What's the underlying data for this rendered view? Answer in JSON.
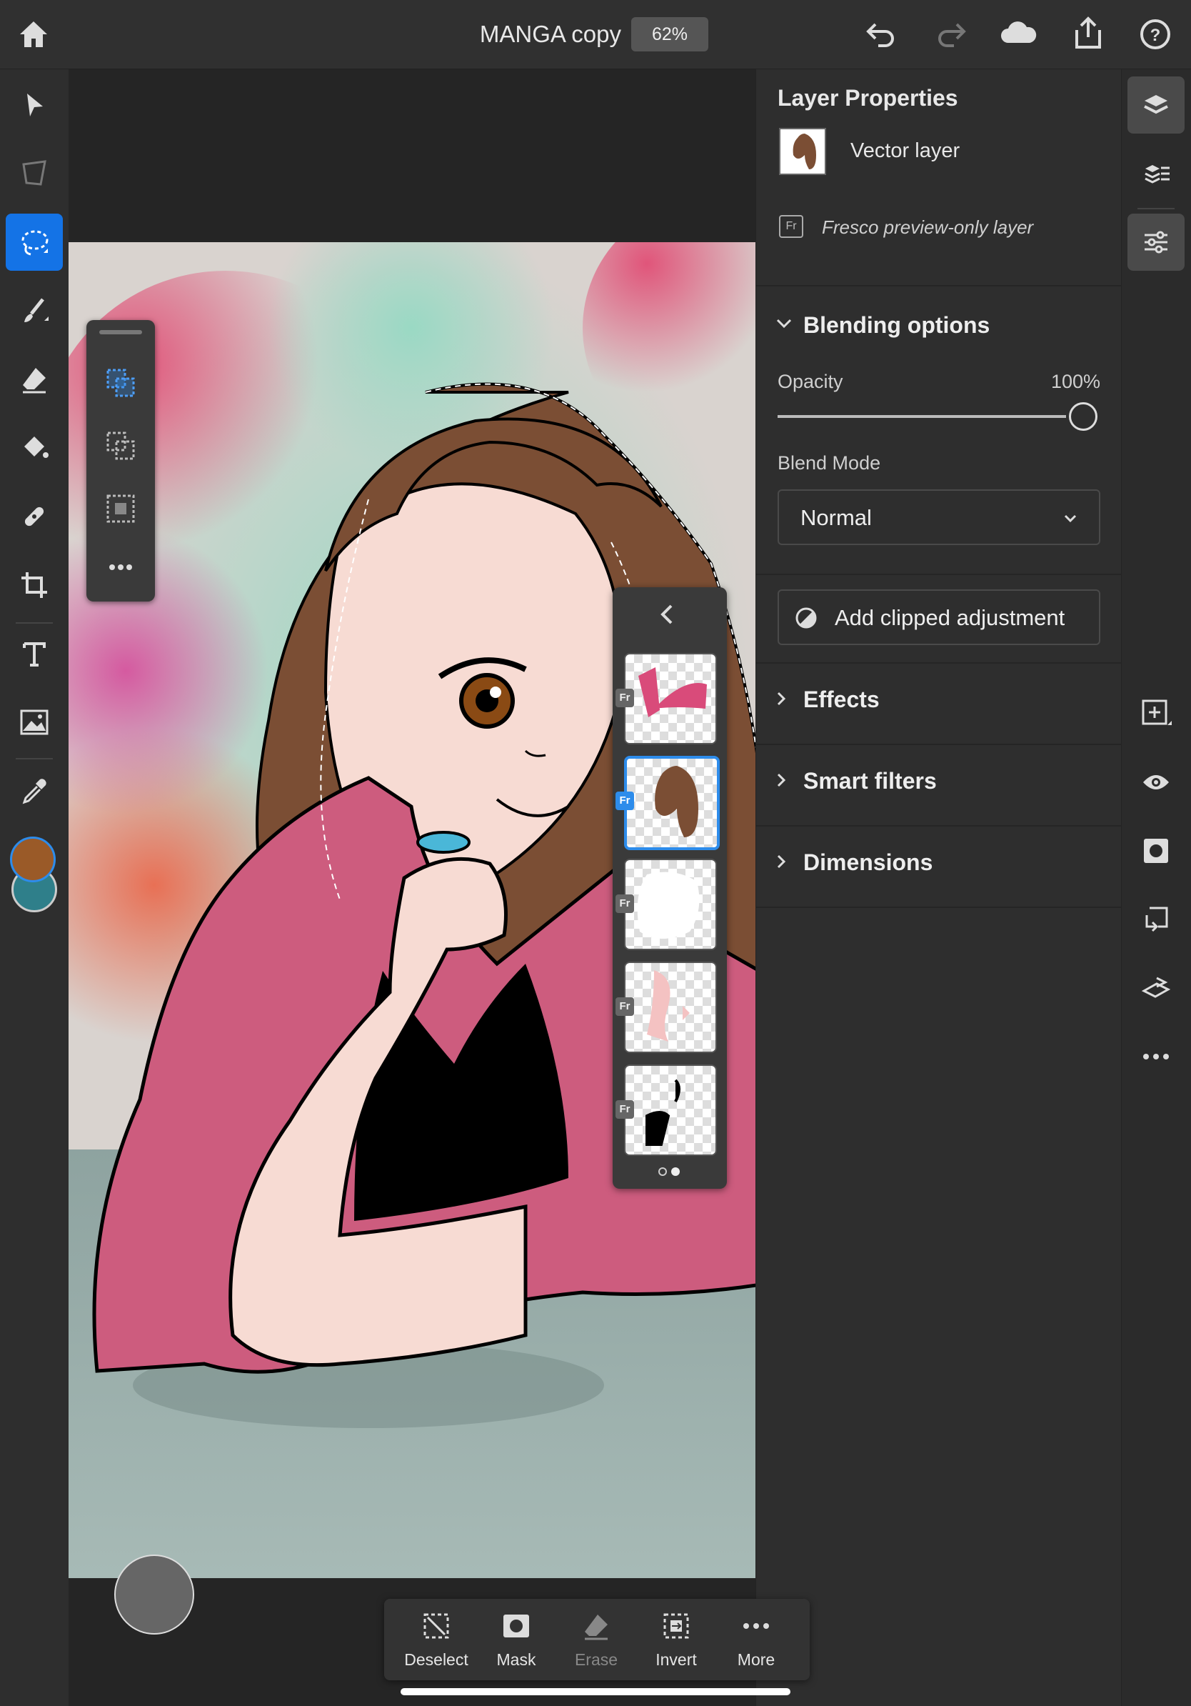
{
  "header": {
    "doc_title": "MANGA copy",
    "zoom": "62%"
  },
  "left_tools": [
    "select-arrow",
    "transform",
    "lasso-selection",
    "brush",
    "eraser",
    "paint-bucket",
    "healing",
    "crop",
    "type",
    "image",
    "eyedropper"
  ],
  "colors": {
    "foreground": "#9a5a28",
    "background": "#2f7f8a",
    "accent": "#1473e6"
  },
  "layer_properties": {
    "title": "Layer Properties",
    "layer_type": "Vector layer",
    "preview_note": "Fresco preview-only layer",
    "blending": {
      "heading": "Blending options",
      "opacity_label": "Opacity",
      "opacity_value": "100%",
      "opacity_fraction": 1.0,
      "blend_mode_label": "Blend Mode",
      "blend_mode_value": "Normal"
    },
    "clipped_adjustment_label": "Add clipped adjustment",
    "sections": [
      "Effects",
      "Smart filters",
      "Dimensions"
    ]
  },
  "layer_thumbnails": {
    "badge": "Fr",
    "count": 5,
    "selected_index": 1
  },
  "action_bar": {
    "deselect": "Deselect",
    "mask": "Mask",
    "erase": "Erase",
    "invert": "Invert",
    "more": "More"
  }
}
